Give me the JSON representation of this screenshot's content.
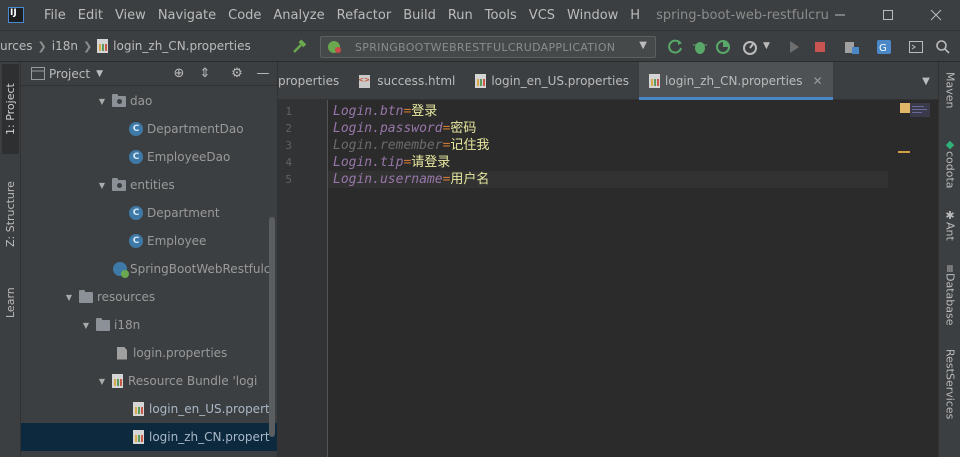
{
  "menu": [
    "File",
    "Edit",
    "View",
    "Navigate",
    "Code",
    "Analyze",
    "Refactor",
    "Build",
    "Run",
    "Tools",
    "VCS",
    "Window",
    "H"
  ],
  "window_title": "spring-boot-web-restfulcru",
  "breadcrumb": [
    "urces",
    "i18n",
    "login_zh_CN.properties"
  ],
  "run_config": "SPRINGBOOTWEBRESTFULCRUDAPPLICATION",
  "left_tabs": [
    "1: Project",
    "Z: Structure",
    "Learn"
  ],
  "right_tabs": [
    "Maven",
    "codota",
    "Ant",
    "Database",
    "RestServices"
  ],
  "project_panel": {
    "title": "Project",
    "tree": [
      {
        "label": "dao",
        "type": "folder",
        "arrow": "▼",
        "depth": 5
      },
      {
        "label": "DepartmentDao",
        "type": "class",
        "depth": 7
      },
      {
        "label": "EmployeeDao",
        "type": "class",
        "depth": 7
      },
      {
        "label": "entities",
        "type": "folder",
        "arrow": "▼",
        "depth": 5
      },
      {
        "label": "Department",
        "type": "class",
        "depth": 7
      },
      {
        "label": "Employee",
        "type": "class",
        "depth": 7
      },
      {
        "label": "SpringBootWebRestfulc",
        "type": "spring",
        "depth": 6
      },
      {
        "label": "resources",
        "type": "folder-res",
        "arrow": "▼",
        "depth": 3
      },
      {
        "label": "i18n",
        "type": "folder",
        "arrow": "▼",
        "depth": 4
      },
      {
        "label": "login.properties",
        "type": "file",
        "depth": 6
      },
      {
        "label": "Resource Bundle 'logi",
        "type": "bundle",
        "arrow": "▼",
        "depth": 5
      },
      {
        "label": "login_en_US.propert",
        "type": "prop",
        "depth": 7
      },
      {
        "label": "login_zh_CN.propert",
        "type": "prop",
        "depth": 7,
        "selected": true
      }
    ]
  },
  "tabs": [
    {
      "label": "properties",
      "icon": "none",
      "active": false
    },
    {
      "label": "success.html",
      "icon": "html",
      "active": false
    },
    {
      "label": "login_en_US.properties",
      "icon": "prop",
      "active": false
    },
    {
      "label": "login_zh_CN.properties",
      "icon": "prop",
      "active": true
    }
  ],
  "editor": {
    "lines": [
      {
        "num": "1",
        "key": "Login.btn",
        "eq": "=",
        "value": "登录",
        "unused": false
      },
      {
        "num": "2",
        "key": "Login.password",
        "eq": "=",
        "value": "密码",
        "unused": false
      },
      {
        "num": "3",
        "key": "Login.remember",
        "eq": "=",
        "value": "记住我",
        "unused": true
      },
      {
        "num": "4",
        "key": "Login.tip",
        "eq": "=",
        "value": "请登录",
        "unused": false
      },
      {
        "num": "5",
        "key": "Login.username",
        "eq": "=",
        "value": "用户名",
        "unused": false
      }
    ],
    "current_line": 5
  }
}
